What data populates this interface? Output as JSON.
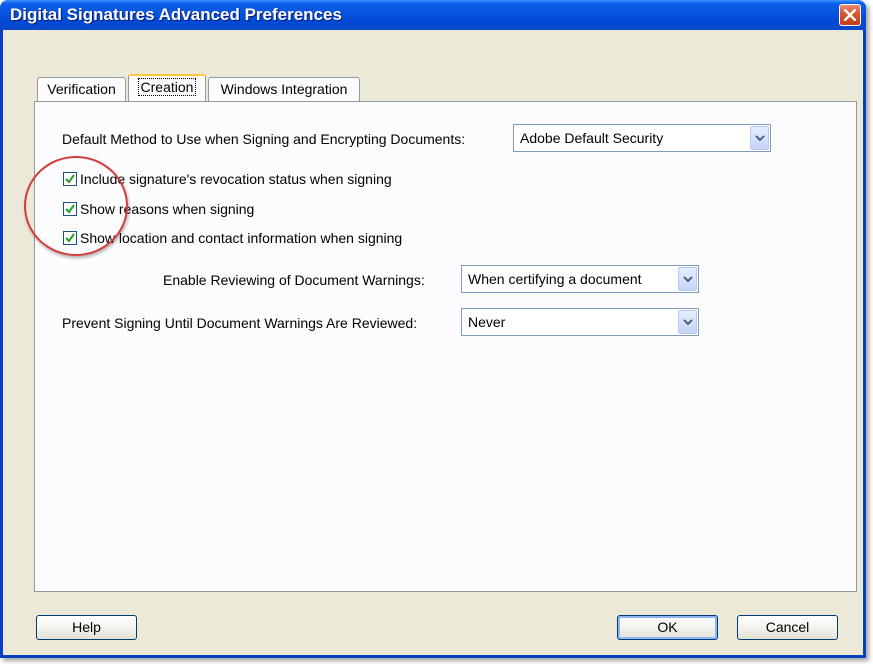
{
  "window": {
    "title": "Digital Signatures Advanced Preferences"
  },
  "tabs": [
    {
      "label": "Verification",
      "active": false
    },
    {
      "label": "Creation",
      "active": true
    },
    {
      "label": "Windows Integration",
      "active": false
    }
  ],
  "creation": {
    "default_method": {
      "label": "Default Method to Use when Signing and Encrypting Documents:",
      "value": "Adobe Default Security"
    },
    "checkboxes": [
      {
        "label": "Include signature's revocation status when signing",
        "checked": true
      },
      {
        "label": "Show reasons when signing",
        "checked": true
      },
      {
        "label": "Show location and contact information when signing",
        "checked": true
      }
    ],
    "enable_reviewing": {
      "label": "Enable Reviewing of Document Warnings:",
      "value": "When certifying a document"
    },
    "prevent_signing": {
      "label": "Prevent Signing Until Document Warnings Are Reviewed:",
      "value": "Never"
    }
  },
  "buttons": {
    "help": "Help",
    "ok": "OK",
    "cancel": "Cancel"
  },
  "icons": {
    "close": "close-icon",
    "dropdown": "chevron-down-icon",
    "check": "checkmark-icon"
  },
  "colors": {
    "titlebar": "#0a55de",
    "dialog_bg": "#ece9d8",
    "check_green": "#21a121",
    "annotation_red": "#d43c3c"
  }
}
